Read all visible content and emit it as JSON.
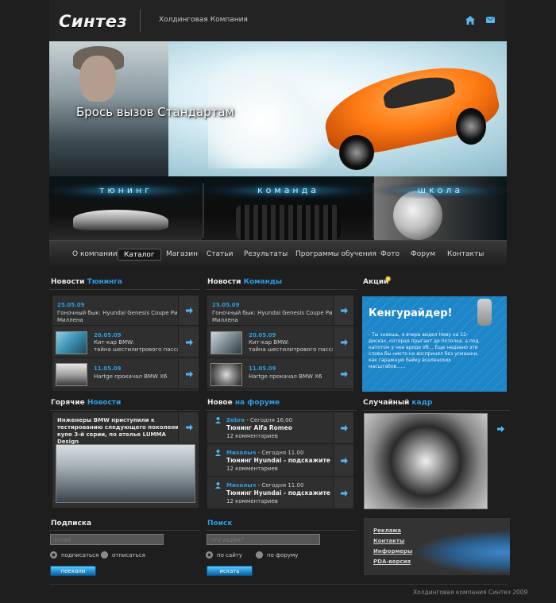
{
  "header": {
    "logo": "Синтез",
    "company": "Холдинговая Компания",
    "icons": [
      "home-icon",
      "mail-icon"
    ]
  },
  "banner": {
    "slogan": "Брось вызов Стандартам"
  },
  "promo_tiles": [
    "тюнинг",
    "команда",
    "школа"
  ],
  "nav": [
    "О компании",
    "Каталог",
    "Магазин",
    "Статьи",
    "Результаты",
    "Программы обучения",
    "Фото",
    "Форум",
    "Контакты"
  ],
  "nav_active": "Каталог",
  "news_tuning": {
    "title_plain": "Новости ",
    "title_hl": "Тюнинга",
    "items": [
      {
        "date": "25.05.09",
        "text1": "Гоночный бык: Hyundai Genesis Coupe Риза",
        "text2": "Миллена"
      },
      {
        "date": "20.05.09",
        "text1": "Кит-кар BMW:",
        "text2": "тайна шестилитрового пассажира"
      },
      {
        "date": "11.05.09",
        "text1": "Hartge прокачал BMW X6",
        "text2": ""
      }
    ]
  },
  "news_team": {
    "title_plain": "Новости ",
    "title_hl": "Команды",
    "items": [
      {
        "date": "25.05.09",
        "text1": "Гоночный бык: Hyundai Genesis Coupe Риза",
        "text2": "Миллена"
      },
      {
        "date": "20.05.09",
        "text1": "Кит-кар BMW:",
        "text2": "тайна шестилитрового пассажира"
      },
      {
        "date": "11.05.09",
        "text1": "Hartge прокачал BMW X6",
        "text2": ""
      }
    ]
  },
  "akcii": {
    "title": "Акции",
    "headline": "Кенгурайдер!",
    "text": "- Ты знаешь, я вчера видел Ниву на 22-дисках, которая прыгает до потолка, а под капотом у нее вроде V8... Еще недавно эти слова бы никто не воспринял без усмешки, как гаражную байку вселенских масштабов......"
  },
  "hot_news": {
    "title_plain": "Горячие ",
    "title_hl": "Новости",
    "text": "Инженеры BMW приступили к тестированию следующего поколения купе 3-й серии, по ателье LUMMA Design"
  },
  "forum": {
    "title_plain": "Новое ",
    "title_hl": "на форуме",
    "items": [
      {
        "author": "Zebra",
        "when": " - Сегодня 16,00",
        "title": "Тюнинг Alfa Romeo",
        "count": "12 комментариев"
      },
      {
        "author": "Михалыч",
        "when": " - Сегодня 11.00",
        "title": "Тюнинг Hyundai - подскажите",
        "count": "12 комментариев"
      },
      {
        "author": "Михалыч",
        "when": " - Сегодня 11.00",
        "title": "Тюнинг Hyundai - подскажите",
        "count": "12 комментариев"
      }
    ]
  },
  "random": {
    "title_plain": "Случайный ",
    "title_hl": "кадр"
  },
  "subscribe": {
    "title": "Подписка",
    "placeholder": "email",
    "opt1": "подписаться",
    "opt2": "отписаться",
    "button": "поехали"
  },
  "search": {
    "title": "Поиск",
    "placeholder": "что ищем?",
    "opt1": "по сайту",
    "opt2": "по форуму",
    "button": "искать"
  },
  "links": [
    "Реклама",
    "Контакты",
    "Информеры",
    "PDA-версия"
  ],
  "footer": "Холдинговая компания Синтез 2009",
  "colors": {
    "accent": "#2c9ee0",
    "bg": "#1e1e1e",
    "promo_blue": "#1c86c9",
    "banner_car": "#ff7a12"
  }
}
